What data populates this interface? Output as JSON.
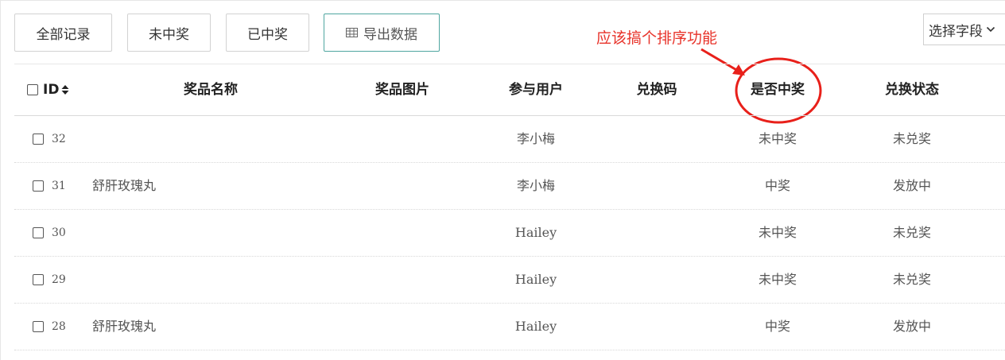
{
  "toolbar": {
    "all_records": "全部记录",
    "not_won": "未中奖",
    "won": "已中奖",
    "export": "导出数据",
    "export_icon": "table-grid-icon",
    "field_select": "选择字段",
    "field_select_icon": "chevron-down-icon"
  },
  "annotation": {
    "text": "应该搞个排序功能",
    "color": "#e8332a"
  },
  "table": {
    "headers": {
      "id": "ID",
      "prize_name": "奖品名称",
      "prize_image": "奖品图片",
      "participant": "参与用户",
      "redeem_code": "兑换码",
      "is_winner": "是否中奖",
      "redeem_status": "兑换状态"
    },
    "sort_icon": "sort-icon",
    "rows": [
      {
        "id": "32",
        "prize_name": "",
        "prize_image": "",
        "participant": "李小梅",
        "redeem_code": "",
        "is_winner": "未中奖",
        "redeem_status": "未兑奖"
      },
      {
        "id": "31",
        "prize_name": "舒肝玫瑰丸",
        "prize_image": "",
        "participant": "李小梅",
        "redeem_code": "",
        "is_winner": "中奖",
        "redeem_status": "发放中"
      },
      {
        "id": "30",
        "prize_name": "",
        "prize_image": "",
        "participant": "Hailey",
        "redeem_code": "",
        "is_winner": "未中奖",
        "redeem_status": "未兑奖"
      },
      {
        "id": "29",
        "prize_name": "",
        "prize_image": "",
        "participant": "Hailey",
        "redeem_code": "",
        "is_winner": "未中奖",
        "redeem_status": "未兑奖"
      },
      {
        "id": "28",
        "prize_name": "舒肝玫瑰丸",
        "prize_image": "",
        "participant": "Hailey",
        "redeem_code": "",
        "is_winner": "中奖",
        "redeem_status": "发放中"
      }
    ]
  }
}
